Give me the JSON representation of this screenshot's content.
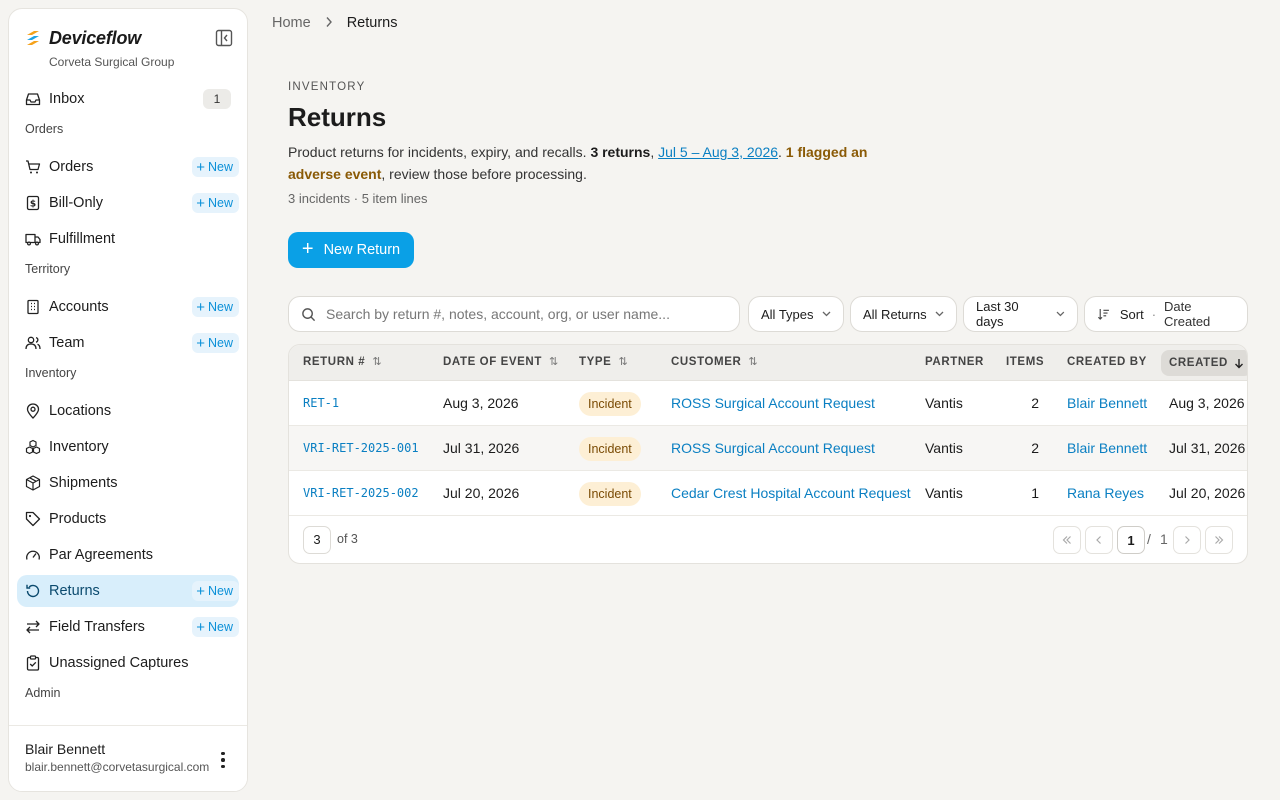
{
  "brand": {
    "name": "Deviceflow",
    "org": "Corveta Surgical Group"
  },
  "nav": {
    "inbox": {
      "label": "Inbox",
      "count": "1"
    },
    "sections": {
      "orders": "Orders",
      "territory": "Territory",
      "inventory": "Inventory",
      "admin": "Admin"
    },
    "items": {
      "orders": "Orders",
      "bill_only": "Bill-Only",
      "fulfillment": "Fulfillment",
      "accounts": "Accounts",
      "team": "Team",
      "locations": "Locations",
      "inventory": "Inventory",
      "shipments": "Shipments",
      "products": "Products",
      "par_agreements": "Par Agreements",
      "returns": "Returns",
      "field_transfers": "Field Transfers",
      "unassigned_captures": "Unassigned Captures"
    },
    "new_label": "New"
  },
  "user": {
    "name": "Blair Bennett",
    "email": "blair.bennett@corvetasurgical.com"
  },
  "breadcrumb": {
    "home": "Home",
    "current": "Returns"
  },
  "page": {
    "eyebrow": "INVENTORY",
    "title": "Returns",
    "desc_prefix": "Product returns for incidents, expiry, and recalls. ",
    "desc_count": "3 returns",
    "desc_comma": ", ",
    "desc_range": "Jul 5 – Aug 3, 2026",
    "desc_dot": ". ",
    "desc_flagged": "1 flagged an adverse event",
    "desc_suffix": ", review those before processing.",
    "meta": "3 incidents · 5 item lines",
    "new_button": "New Return"
  },
  "search": {
    "placeholder": "Search by return #, notes, account, org, or user name..."
  },
  "filters": {
    "types": "All Types",
    "returns": "All Returns",
    "days": "Last 30 days",
    "sort_label": "Sort",
    "sort_sep": "·",
    "sort_value": "Date Created"
  },
  "table": {
    "headers": {
      "return_no": "RETURN #",
      "date_of_event": "DATE OF EVENT",
      "type": "TYPE",
      "customer": "CUSTOMER",
      "partner": "PARTNER",
      "items": "ITEMS",
      "created_by": "CREATED BY",
      "created": "CREATED"
    },
    "rows": [
      {
        "return_no": "RET-1",
        "date_of_event": "Aug 3, 2026",
        "type": "Incident",
        "customer": "ROSS Surgical Account Request",
        "partner": "Vantis",
        "items": "2",
        "created_by": "Blair Bennett",
        "created": "Aug 3, 2026"
      },
      {
        "return_no": "VRI-RET-2025-001",
        "date_of_event": "Jul 31, 2026",
        "type": "Incident",
        "customer": "ROSS Surgical Account Request",
        "partner": "Vantis",
        "items": "2",
        "created_by": "Blair Bennett",
        "created": "Jul 31, 2026"
      },
      {
        "return_no": "VRI-RET-2025-002",
        "date_of_event": "Jul 20, 2026",
        "type": "Incident",
        "customer": "Cedar Crest Hospital Account Request",
        "partner": "Vantis",
        "items": "1",
        "created_by": "Rana Reyes",
        "created": "Jul 20, 2026"
      }
    ],
    "footer": {
      "page_size": "3",
      "of_total": "of 3",
      "current_page": "1",
      "sep": "/",
      "total_pages": "1"
    }
  },
  "colors": {
    "accent": "#0aa0e6",
    "link": "#0a7fc2",
    "active_nav_bg": "#d8eefb",
    "warning_text": "#8a5a06",
    "incident_pill_bg": "#fdefd5"
  }
}
